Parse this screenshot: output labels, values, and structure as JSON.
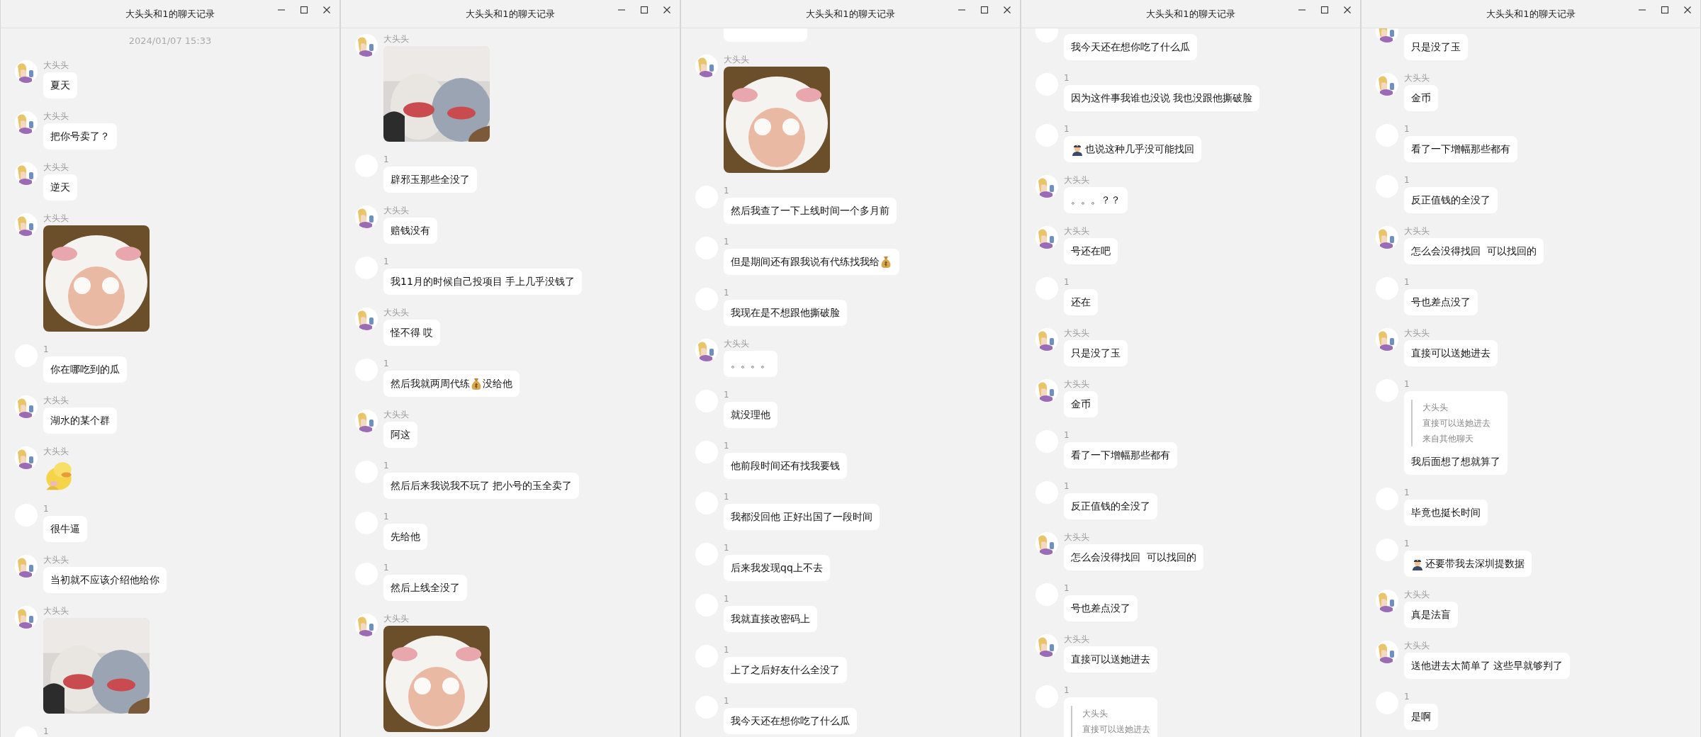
{
  "windows": [
    {
      "title": "大头头和1的聊天记录",
      "messages": [
        {
          "kind": "timestamp",
          "text": "2024/01/07 15:33"
        },
        {
          "kind": "text",
          "sender": "大头头",
          "photo_avatar": true,
          "parts": [
            {
              "kind": "text",
              "text": "夏天"
            }
          ]
        },
        {
          "kind": "text",
          "sender": "大头头",
          "photo_avatar": true,
          "parts": [
            {
              "kind": "text",
              "text": "把你号卖了？"
            }
          ]
        },
        {
          "kind": "text",
          "sender": "大头头",
          "photo_avatar": true,
          "parts": [
            {
              "kind": "text",
              "text": "逆天"
            }
          ]
        },
        {
          "kind": "picture",
          "sender": "大头头",
          "photo_avatar": true
        },
        {
          "kind": "text",
          "sender": "1",
          "photo_avatar": false,
          "parts": [
            {
              "kind": "text",
              "text": "你在哪吃到的瓜"
            }
          ]
        },
        {
          "kind": "text",
          "sender": "大头头",
          "photo_avatar": true,
          "parts": [
            {
              "kind": "text",
              "text": "湖水的某个群"
            }
          ]
        },
        {
          "kind": "sticker",
          "sender": "大头头",
          "photo_avatar": true
        },
        {
          "kind": "text",
          "sender": "1",
          "photo_avatar": false,
          "parts": [
            {
              "kind": "text",
              "text": "很牛逼"
            }
          ]
        },
        {
          "kind": "text",
          "sender": "大头头",
          "photo_avatar": true,
          "parts": [
            {
              "kind": "text",
              "text": "当初就不应该介绍他给你"
            }
          ]
        },
        {
          "kind": "wide_picture",
          "sender": "大头头",
          "photo_avatar": true
        },
        {
          "kind": "cut",
          "sender": "1",
          "photo_avatar": false
        }
      ]
    },
    {
      "title": "大头头和1的聊天记录",
      "messages": [
        {
          "kind": "wide_picture",
          "sender": "大头头",
          "photo_avatar": true
        },
        {
          "kind": "text",
          "sender": "1",
          "photo_avatar": false,
          "parts": [
            {
              "kind": "text",
              "text": "辟邪玉那些全没了"
            }
          ]
        },
        {
          "kind": "text",
          "sender": "大头头",
          "photo_avatar": true,
          "parts": [
            {
              "kind": "text",
              "text": "赔钱没有"
            }
          ]
        },
        {
          "kind": "text",
          "sender": "1",
          "photo_avatar": false,
          "parts": [
            {
              "kind": "text",
              "text": "我11月的时候自己投项目 手上几乎没钱了"
            }
          ]
        },
        {
          "kind": "text",
          "sender": "大头头",
          "photo_avatar": true,
          "parts": [
            {
              "kind": "text",
              "text": "怪不得 哎"
            }
          ]
        },
        {
          "kind": "text",
          "sender": "1",
          "photo_avatar": false,
          "parts": [
            {
              "kind": "text",
              "text": "然后我就两周代练"
            },
            {
              "kind": "moneybag"
            },
            {
              "kind": "text",
              "text": "没给他"
            }
          ]
        },
        {
          "kind": "text",
          "sender": "大头头",
          "photo_avatar": true,
          "parts": [
            {
              "kind": "text",
              "text": "阿这"
            }
          ]
        },
        {
          "kind": "text",
          "sender": "1",
          "photo_avatar": false,
          "parts": [
            {
              "kind": "text",
              "text": "然后后来我说我不玩了 把小号的玉全卖了"
            }
          ]
        },
        {
          "kind": "text",
          "sender": "1",
          "photo_avatar": false,
          "parts": [
            {
              "kind": "text",
              "text": "先给他"
            }
          ]
        },
        {
          "kind": "text",
          "sender": "1",
          "photo_avatar": false,
          "parts": [
            {
              "kind": "text",
              "text": "然后上线全没了"
            }
          ]
        },
        {
          "kind": "picture",
          "sender": "大头头",
          "photo_avatar": true
        }
      ]
    },
    {
      "title": "大头头和1的聊天记录",
      "messages": [
        {
          "kind": "stub"
        },
        {
          "kind": "picture",
          "sender": "大头头",
          "photo_avatar": true
        },
        {
          "kind": "text",
          "sender": "1",
          "photo_avatar": false,
          "parts": [
            {
              "kind": "text",
              "text": "然后我查了一下上线时间一个多月前"
            }
          ]
        },
        {
          "kind": "text",
          "sender": "1",
          "photo_avatar": false,
          "parts": [
            {
              "kind": "text",
              "text": "但是期间还有跟我说有代练找我给"
            },
            {
              "kind": "moneybag"
            }
          ]
        },
        {
          "kind": "text",
          "sender": "1",
          "photo_avatar": false,
          "parts": [
            {
              "kind": "text",
              "text": "我现在是不想跟他撕破脸"
            }
          ]
        },
        {
          "kind": "text",
          "sender": "大头头",
          "photo_avatar": true,
          "parts": [
            {
              "kind": "text",
              "text": "。。。。"
            }
          ]
        },
        {
          "kind": "text",
          "sender": "1",
          "photo_avatar": false,
          "parts": [
            {
              "kind": "text",
              "text": "就没理他"
            }
          ]
        },
        {
          "kind": "text",
          "sender": "1",
          "photo_avatar": false,
          "parts": [
            {
              "kind": "text",
              "text": "他前段时间还有找我要钱"
            }
          ]
        },
        {
          "kind": "text",
          "sender": "1",
          "photo_avatar": false,
          "parts": [
            {
              "kind": "text",
              "text": "我都没回他 正好出国了一段时间"
            }
          ]
        },
        {
          "kind": "text",
          "sender": "1",
          "photo_avatar": false,
          "parts": [
            {
              "kind": "text",
              "text": "后来我发现qq上不去"
            }
          ]
        },
        {
          "kind": "text",
          "sender": "1",
          "photo_avatar": false,
          "parts": [
            {
              "kind": "text",
              "text": "我就直接改密码上"
            }
          ]
        },
        {
          "kind": "text",
          "sender": "1",
          "photo_avatar": false,
          "parts": [
            {
              "kind": "text",
              "text": "上了之后好友什么全没了"
            }
          ]
        },
        {
          "kind": "text",
          "sender": "1",
          "photo_avatar": false,
          "parts": [
            {
              "kind": "text",
              "text": "我今天还在想你吃了什么瓜"
            }
          ]
        }
      ]
    },
    {
      "title": "大头头和1的聊天记录",
      "messages": [
        {
          "kind": "text",
          "photo_avatar": false,
          "parts": [
            {
              "kind": "text",
              "text": "我今天还在想你吃了什么瓜"
            }
          ]
        },
        {
          "kind": "text",
          "sender": "1",
          "photo_avatar": false,
          "parts": [
            {
              "kind": "text",
              "text": "因为这件事我谁也没说 我也没跟他撕破脸"
            }
          ]
        },
        {
          "kind": "text",
          "sender": "1",
          "photo_avatar": false,
          "parts": [
            {
              "kind": "officer"
            },
            {
              "kind": "text",
              "text": "也说这种几乎没可能找回"
            }
          ]
        },
        {
          "kind": "text",
          "sender": "大头头",
          "photo_avatar": true,
          "parts": [
            {
              "kind": "text",
              "text": "。。。？？"
            }
          ]
        },
        {
          "kind": "text",
          "sender": "大头头",
          "photo_avatar": true,
          "parts": [
            {
              "kind": "text",
              "text": "号还在吧"
            }
          ]
        },
        {
          "kind": "text",
          "sender": "1",
          "photo_avatar": false,
          "parts": [
            {
              "kind": "text",
              "text": "还在"
            }
          ]
        },
        {
          "kind": "text",
          "sender": "大头头",
          "photo_avatar": true,
          "parts": [
            {
              "kind": "text",
              "text": "只是没了玉"
            }
          ]
        },
        {
          "kind": "text",
          "sender": "大头头",
          "photo_avatar": true,
          "parts": [
            {
              "kind": "text",
              "text": "金币"
            }
          ]
        },
        {
          "kind": "text",
          "sender": "1",
          "photo_avatar": false,
          "parts": [
            {
              "kind": "text",
              "text": "看了一下增幅那些都有"
            }
          ]
        },
        {
          "kind": "text",
          "sender": "1",
          "photo_avatar": false,
          "parts": [
            {
              "kind": "text",
              "text": "反正值钱的全没了"
            }
          ]
        },
        {
          "kind": "text",
          "sender": "大头头",
          "photo_avatar": true,
          "parts": [
            {
              "kind": "text",
              "text": "怎么会没得找回  可以找回的"
            }
          ]
        },
        {
          "kind": "text",
          "sender": "1",
          "photo_avatar": false,
          "parts": [
            {
              "kind": "text",
              "text": "号也差点没了"
            }
          ]
        },
        {
          "kind": "text",
          "sender": "大头头",
          "photo_avatar": true,
          "parts": [
            {
              "kind": "text",
              "text": "直接可以送她进去"
            }
          ]
        },
        {
          "kind": "quote",
          "sender": "1",
          "photo_avatar": false,
          "quote": {
            "name": "大头头",
            "text": "直接可以送她进去"
          }
        }
      ]
    },
    {
      "title": "大头头和1的聊天记录",
      "messages": [
        {
          "kind": "text",
          "photo_avatar": true,
          "parts": [
            {
              "kind": "text",
              "text": "只是没了玉"
            }
          ]
        },
        {
          "kind": "text",
          "sender": "大头头",
          "photo_avatar": true,
          "parts": [
            {
              "kind": "text",
              "text": "金币"
            }
          ]
        },
        {
          "kind": "text",
          "sender": "1",
          "photo_avatar": false,
          "parts": [
            {
              "kind": "text",
              "text": "看了一下增幅那些都有"
            }
          ]
        },
        {
          "kind": "text",
          "sender": "1",
          "photo_avatar": false,
          "parts": [
            {
              "kind": "text",
              "text": "反正值钱的全没了"
            }
          ]
        },
        {
          "kind": "text",
          "sender": "大头头",
          "photo_avatar": true,
          "parts": [
            {
              "kind": "text",
              "text": "怎么会没得找回  可以找回的"
            }
          ]
        },
        {
          "kind": "text",
          "sender": "1",
          "photo_avatar": false,
          "parts": [
            {
              "kind": "text",
              "text": "号也差点没了"
            }
          ]
        },
        {
          "kind": "text",
          "sender": "大头头",
          "photo_avatar": true,
          "parts": [
            {
              "kind": "text",
              "text": "直接可以送她进去"
            }
          ]
        },
        {
          "kind": "quote",
          "sender": "1",
          "photo_avatar": false,
          "quote": {
            "name": "大头头",
            "text": "直接可以送她进去",
            "source": "来自其他聊天"
          },
          "parts": [
            {
              "kind": "text",
              "text": "我后面想了想就算了"
            }
          ]
        },
        {
          "kind": "text",
          "sender": "1",
          "photo_avatar": false,
          "parts": [
            {
              "kind": "text",
              "text": "毕竟也挺长时间"
            }
          ]
        },
        {
          "kind": "text",
          "sender": "1",
          "photo_avatar": false,
          "parts": [
            {
              "kind": "officer"
            },
            {
              "kind": "text",
              "text": "还要带我去深圳提数据"
            }
          ]
        },
        {
          "kind": "text",
          "sender": "大头头",
          "photo_avatar": true,
          "parts": [
            {
              "kind": "text",
              "text": "真是法盲"
            }
          ]
        },
        {
          "kind": "text",
          "sender": "大头头",
          "photo_avatar": true,
          "parts": [
            {
              "kind": "text",
              "text": "送他进去太简单了 这些早就够判了"
            }
          ]
        },
        {
          "kind": "text",
          "sender": "1",
          "photo_avatar": false,
          "parts": [
            {
              "kind": "text",
              "text": "是啊"
            }
          ]
        }
      ]
    }
  ]
}
